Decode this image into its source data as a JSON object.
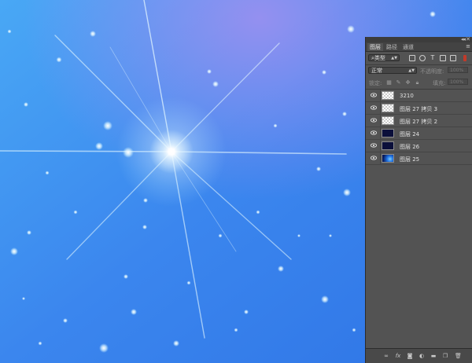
{
  "panel": {
    "tabs": [
      "图层",
      "路径",
      "通道"
    ],
    "filter": {
      "kind": "类型",
      "icons": [
        "pixel-filter-icon",
        "adjustment-filter-icon",
        "type-filter-icon",
        "shape-filter-icon",
        "smart-object-filter-icon"
      ]
    },
    "blend_mode": "正常",
    "opacity_label": "不透明度:",
    "opacity_value": "100%",
    "lock_label": "锁定:",
    "fill_label": "填充:",
    "fill_value": "100%",
    "layers": [
      {
        "name": "3210",
        "thumb": "checker",
        "visible": true
      },
      {
        "name": "图层 27 拷贝 3",
        "thumb": "checker",
        "visible": true
      },
      {
        "name": "图层 27 拷贝 2",
        "thumb": "checker",
        "visible": true
      },
      {
        "name": "图层 24",
        "thumb": "dark",
        "visible": true
      },
      {
        "name": "图层 26",
        "thumb": "dark",
        "visible": true
      },
      {
        "name": "图层 25",
        "thumb": "blue",
        "visible": true
      }
    ],
    "bottom_icons": [
      "link-layers-icon",
      "fx-icon",
      "mask-icon",
      "adjustment-layer-icon",
      "group-folder-icon",
      "new-layer-icon",
      "trash-icon"
    ]
  },
  "colors": {
    "panel_bg": "#535353",
    "canvas_sky": "#3a8ef0",
    "toggle_red": "#c23a2a"
  }
}
